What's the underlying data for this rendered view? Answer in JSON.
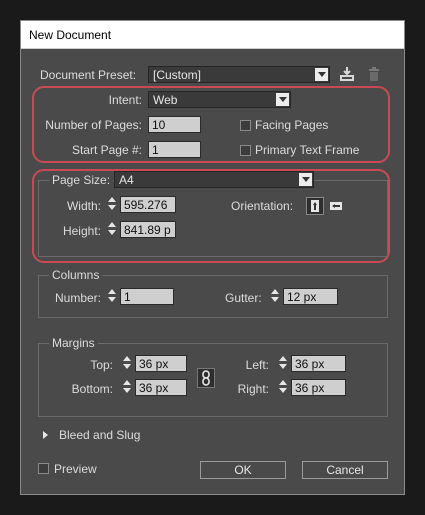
{
  "window": {
    "title": "New Document"
  },
  "preset": {
    "label": "Document Preset:",
    "value": "[Custom]",
    "save_icon": "save-preset-icon",
    "delete_icon": "trash-icon"
  },
  "intent": {
    "label": "Intent:",
    "value": "Web"
  },
  "pages": {
    "number_label": "Number of Pages:",
    "number_value": "10",
    "start_label": "Start Page #:",
    "start_value": "1",
    "facing_label": "Facing Pages",
    "facing_checked": false,
    "primary_label": "Primary Text Frame",
    "primary_checked": false
  },
  "page_size": {
    "label": "Page Size:",
    "value": "A4",
    "width_label": "Width:",
    "width_value": "595.276",
    "height_label": "Height:",
    "height_value": "841.89 p",
    "orientation_label": "Orientation:",
    "orientation_icons": [
      "portrait-icon",
      "landscape-icon"
    ]
  },
  "columns": {
    "title": "Columns",
    "number_label": "Number:",
    "number_value": "1",
    "gutter_label": "Gutter:",
    "gutter_value": "12 px"
  },
  "margins": {
    "title": "Margins",
    "top_label": "Top:",
    "top_value": "36 px",
    "bottom_label": "Bottom:",
    "bottom_value": "36 px",
    "left_label": "Left:",
    "left_value": "36 px",
    "right_label": "Right:",
    "right_value": "36 px",
    "link_icon": "chain-link-icon"
  },
  "bleed": {
    "label": "Bleed and Slug"
  },
  "footer": {
    "preview_label": "Preview",
    "preview_checked": false,
    "ok_label": "OK",
    "cancel_label": "Cancel"
  },
  "colors": {
    "highlight": "#c94a55",
    "dialog_bg": "#4a4a4a",
    "field_bg": "#cfcfcf"
  }
}
